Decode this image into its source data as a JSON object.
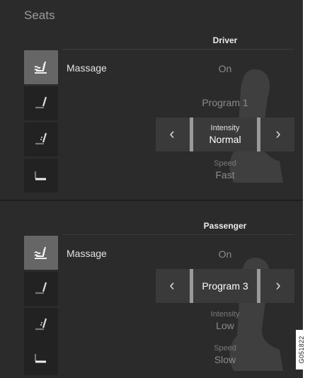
{
  "title": "Seats",
  "driver": {
    "heading": "Driver",
    "massage_label": "Massage",
    "massage_value": "On",
    "program_value": "Program 1",
    "intensity_label": "Intensity",
    "intensity_value": "Normal",
    "speed_label": "Speed",
    "speed_value": "Fast"
  },
  "passenger": {
    "heading": "Passenger",
    "massage_label": "Massage",
    "massage_value": "On",
    "program_value": "Program 3",
    "intensity_label": "Intensity",
    "intensity_value": "Low",
    "speed_label": "Speed",
    "speed_value": "Slow"
  },
  "arrows": {
    "left": "‹",
    "right": "›"
  },
  "icons": [
    "seat-massage-icon",
    "seat-backrest-icon",
    "seat-lumbar-icon",
    "seat-cushion-icon"
  ],
  "figure_code": "G051822",
  "colors": {
    "background": "#2b2b2b",
    "active_tile": "#666666",
    "stepper": "#3a3a3a",
    "text": "#e3e3e3"
  }
}
